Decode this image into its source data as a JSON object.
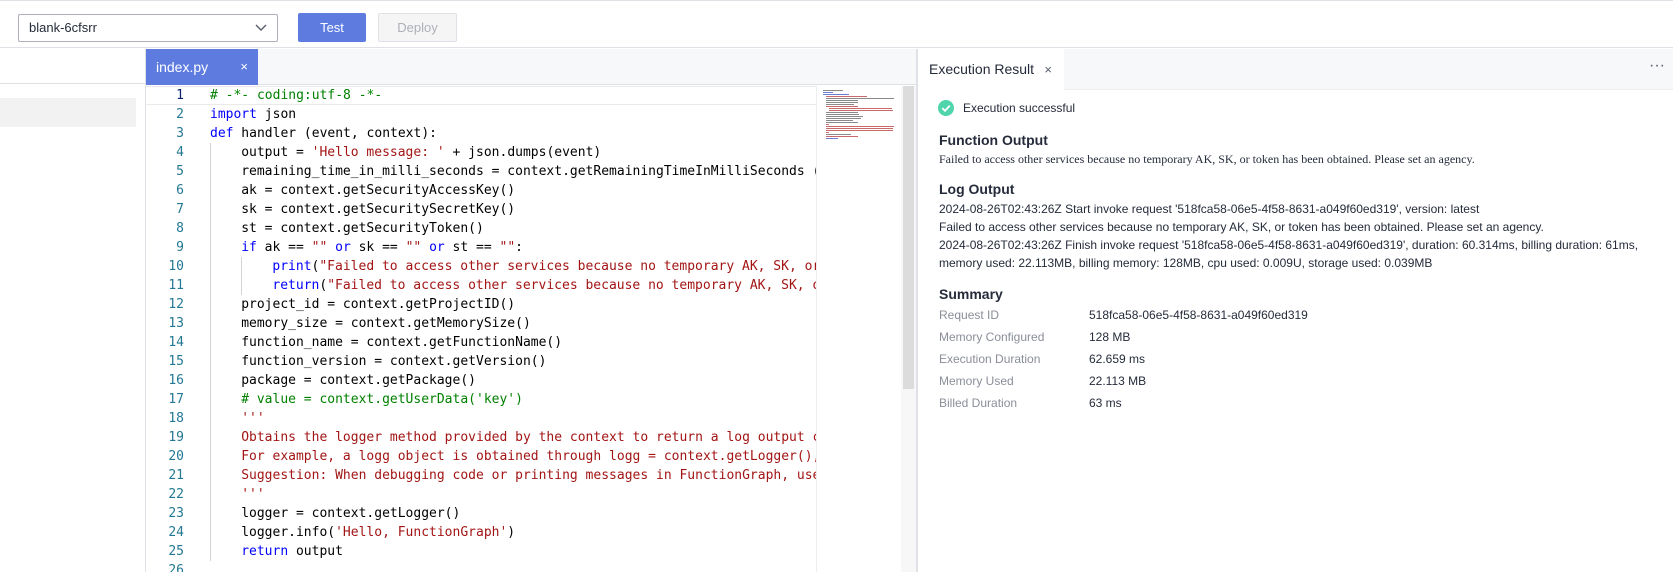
{
  "toolbar": {
    "function_select": "blank-6cfsrr",
    "test_label": "Test",
    "deploy_label": "Deploy"
  },
  "editor": {
    "tab_label": "index.py",
    "tab_close": "×",
    "lines": [
      {
        "n": "1",
        "indent": 0,
        "tokens": [
          {
            "t": "# -*- coding:utf-8 -*-",
            "c": "cm"
          }
        ]
      },
      {
        "n": "2",
        "indent": 0,
        "tokens": [
          {
            "t": "import",
            "c": "kw"
          },
          {
            "t": " json",
            "c": ""
          }
        ]
      },
      {
        "n": "3",
        "indent": 0,
        "tokens": [
          {
            "t": "def",
            "c": "kw"
          },
          {
            "t": " handler (event, context):",
            "c": ""
          }
        ]
      },
      {
        "n": "4",
        "indent": 1,
        "tokens": [
          {
            "t": "output = ",
            "c": ""
          },
          {
            "t": "'Hello message: '",
            "c": "str"
          },
          {
            "t": " + json.dumps(event)",
            "c": ""
          }
        ]
      },
      {
        "n": "5",
        "indent": 1,
        "tokens": [
          {
            "t": "remaining_time_in_milli_seconds = context.getRemainingTimeInMilliSeconds ()",
            "c": ""
          }
        ]
      },
      {
        "n": "6",
        "indent": 1,
        "tokens": [
          {
            "t": "ak = context.getSecurityAccessKey()",
            "c": ""
          }
        ]
      },
      {
        "n": "7",
        "indent": 1,
        "tokens": [
          {
            "t": "sk = context.getSecuritySecretKey()",
            "c": ""
          }
        ]
      },
      {
        "n": "8",
        "indent": 1,
        "tokens": [
          {
            "t": "st = context.getSecurityToken()",
            "c": ""
          }
        ]
      },
      {
        "n": "9",
        "indent": 1,
        "tokens": [
          {
            "t": "if",
            "c": "kw"
          },
          {
            "t": " ak == ",
            "c": ""
          },
          {
            "t": "\"\"",
            "c": "str"
          },
          {
            "t": " ",
            "c": ""
          },
          {
            "t": "or",
            "c": "kw"
          },
          {
            "t": " sk == ",
            "c": ""
          },
          {
            "t": "\"\"",
            "c": "str"
          },
          {
            "t": " ",
            "c": ""
          },
          {
            "t": "or",
            "c": "kw"
          },
          {
            "t": " st == ",
            "c": ""
          },
          {
            "t": "\"\"",
            "c": "str"
          },
          {
            "t": ":",
            "c": ""
          }
        ]
      },
      {
        "n": "10",
        "indent": 2,
        "tokens": [
          {
            "t": "print",
            "c": "kw"
          },
          {
            "t": "(",
            "c": ""
          },
          {
            "t": "\"Failed to access other services because no temporary AK, SK, or",
            "c": "str"
          }
        ]
      },
      {
        "n": "11",
        "indent": 2,
        "tokens": [
          {
            "t": "return",
            "c": "kw"
          },
          {
            "t": "(",
            "c": ""
          },
          {
            "t": "\"Failed to access other services because no temporary AK, SK, or",
            "c": "str"
          }
        ]
      },
      {
        "n": "12",
        "indent": 1,
        "tokens": [
          {
            "t": "project_id = context.getProjectID()",
            "c": ""
          }
        ]
      },
      {
        "n": "13",
        "indent": 1,
        "tokens": [
          {
            "t": "memory_size = context.getMemorySize()",
            "c": ""
          }
        ]
      },
      {
        "n": "14",
        "indent": 1,
        "tokens": [
          {
            "t": "function_name = context.getFunctionName()",
            "c": ""
          }
        ]
      },
      {
        "n": "15",
        "indent": 1,
        "tokens": [
          {
            "t": "function_version = context.getVersion()",
            "c": ""
          }
        ]
      },
      {
        "n": "16",
        "indent": 1,
        "tokens": [
          {
            "t": "package = context.getPackage()",
            "c": ""
          }
        ]
      },
      {
        "n": "17",
        "indent": 1,
        "tokens": [
          {
            "t": "# value = context.getUserData('key')",
            "c": "cm"
          }
        ]
      },
      {
        "n": "18",
        "indent": 1,
        "tokens": [
          {
            "t": "'''",
            "c": "str"
          }
        ]
      },
      {
        "n": "19",
        "indent": 1,
        "tokens": [
          {
            "t": "Obtains the logger method provided by the context to return a log output cl",
            "c": "str"
          }
        ]
      },
      {
        "n": "20",
        "indent": 1,
        "tokens": [
          {
            "t": "For example, a logg object is obtained through logg = context.getLogger(),",
            "c": "str"
          }
        ]
      },
      {
        "n": "21",
        "indent": 1,
        "tokens": [
          {
            "t": "Suggestion: When debugging code or printing messages in FunctionGraph, use",
            "c": "str"
          }
        ]
      },
      {
        "n": "22",
        "indent": 1,
        "tokens": [
          {
            "t": "'''",
            "c": "str"
          }
        ]
      },
      {
        "n": "23",
        "indent": 1,
        "tokens": [
          {
            "t": "logger = context.getLogger()",
            "c": ""
          }
        ]
      },
      {
        "n": "24",
        "indent": 1,
        "tokens": [
          {
            "t": "logger.info(",
            "c": ""
          },
          {
            "t": "'Hello, FunctionGraph'",
            "c": "str"
          },
          {
            "t": ")",
            "c": ""
          }
        ]
      },
      {
        "n": "25",
        "indent": 1,
        "tokens": [
          {
            "t": "return",
            "c": "kw"
          },
          {
            "t": " output",
            "c": ""
          }
        ]
      },
      {
        "n": "26",
        "indent": 0,
        "tokens": []
      }
    ]
  },
  "result": {
    "tab_label": "Execution Result",
    "tab_close": "×",
    "more": "···",
    "status": "Execution successful",
    "function_output_title": "Function Output",
    "function_output": "Failed to access other services because no temporary AK, SK, or token has been obtained. Please set an agency.",
    "log_output_title": "Log Output",
    "log_lines": [
      "2024-08-26T02:43:26Z Start invoke request '518fca58-06e5-4f58-8631-a049f60ed319', version: latest",
      "Failed to access other services because no temporary AK, SK, or token has been obtained. Please set an agency.",
      "2024-08-26T02:43:26Z Finish invoke request '518fca58-06e5-4f58-8631-a049f60ed319', duration: 60.314ms, billing duration: 61ms,",
      "memory used: 22.113MB, billing memory: 128MB, cpu used: 0.009U, storage used: 0.039MB"
    ],
    "summary_title": "Summary",
    "summary": [
      {
        "label": "Request ID",
        "value": "518fca58-06e5-4f58-8631-a049f60ed319"
      },
      {
        "label": "Memory Configured",
        "value": "128 MB"
      },
      {
        "label": "Execution Duration",
        "value": "62.659 ms"
      },
      {
        "label": "Memory Used",
        "value": "22.113 MB"
      },
      {
        "label": "Billed Duration",
        "value": "63 ms"
      }
    ]
  },
  "colors": {
    "accent": "#5e7ce0",
    "success": "#50d4ab",
    "keyword": "#0000ff",
    "string": "#a31515",
    "comment": "#008000"
  }
}
